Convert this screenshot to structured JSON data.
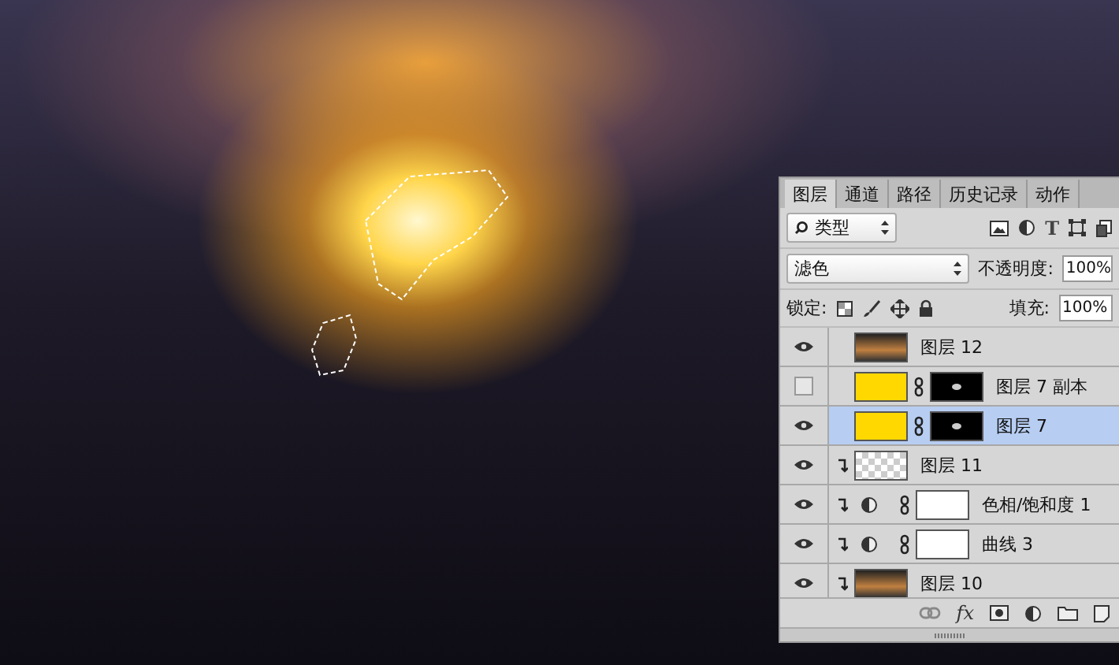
{
  "panel": {
    "tabs": [
      {
        "label": "图层",
        "selected": true
      },
      {
        "label": "通道",
        "selected": false
      },
      {
        "label": "路径",
        "selected": false
      },
      {
        "label": "历史记录",
        "selected": false
      },
      {
        "label": "动作",
        "selected": false
      }
    ],
    "filter": {
      "value": "类型",
      "type_icon": "T"
    },
    "blend": {
      "mode": "滤色",
      "opacity_label": "不透明度:",
      "opacity": "100%"
    },
    "lock": {
      "label": "锁定:",
      "fill_label": "填充:",
      "fill": "100%"
    },
    "layers": [
      {
        "name": "图层 12",
        "visible": true,
        "clipped": false,
        "thumbnail": {
          "kind": "photo"
        },
        "adjustment": false,
        "selected": false
      },
      {
        "name": "图层 7 副本",
        "visible": false,
        "clipped": false,
        "thumbnail": {
          "kind": "color",
          "color": "#ffd800"
        },
        "mask": {
          "kind": "dark"
        },
        "adjustment": false,
        "selected": false
      },
      {
        "name": "图层 7",
        "visible": true,
        "clipped": false,
        "thumbnail": {
          "kind": "color",
          "color": "#ffd800"
        },
        "mask": {
          "kind": "dark"
        },
        "adjustment": false,
        "selected": true
      },
      {
        "name": "图层 11",
        "visible": true,
        "clipped": true,
        "thumbnail": {
          "kind": "transparent"
        },
        "adjustment": false,
        "selected": false
      },
      {
        "name": "色相/饱和度 1",
        "visible": true,
        "clipped": true,
        "mask": {
          "kind": "white"
        },
        "adjustment": true,
        "selected": false
      },
      {
        "name": "曲线 3",
        "visible": true,
        "clipped": true,
        "mask": {
          "kind": "white"
        },
        "adjustment": true,
        "selected": false
      },
      {
        "name": "图层 10",
        "visible": true,
        "clipped": true,
        "thumbnail": {
          "kind": "photo"
        },
        "adjustment": false,
        "selected": false
      }
    ],
    "fx_label": "fx"
  }
}
